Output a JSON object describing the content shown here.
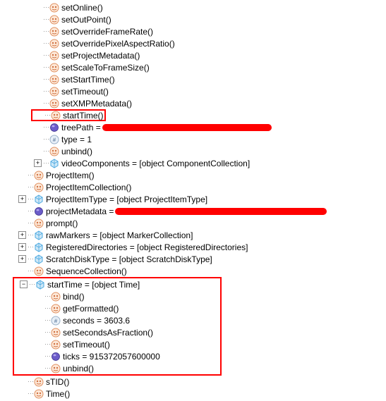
{
  "nodes": {
    "setOnline": "setOnline()",
    "setOutPoint": "setOutPoint()",
    "setOverrideFrameRate": "setOverrideFrameRate()",
    "setOverridePixelAspectRatio": "setOverridePixelAspectRatio()",
    "setProjectMetadata": "setProjectMetadata()",
    "setScaleToFrameSize": "setScaleToFrameSize()",
    "setStartTime": "setStartTime()",
    "setTimeout": "setTimeout()",
    "setXMPMetadata": "setXMPMetadata()",
    "startTimeMethod": "startTime()",
    "treePath": "treePath = ",
    "type": "type = 1",
    "unbind": "unbind()",
    "videoComponents": "videoComponents = [object ComponentCollection]",
    "ProjectItem": "ProjectItem()",
    "ProjectItemCollection": "ProjectItemCollection()",
    "ProjectItemType": "ProjectItemType = [object ProjectItemType]",
    "projectMetadata": "projectMetadata = ",
    "prompt": "prompt()",
    "rawMarkers": "rawMarkers = [object MarkerCollection]",
    "RegisteredDirectories": "RegisteredDirectories = [object RegisteredDirectories]",
    "ScratchDiskType": "ScratchDiskType = [object ScratchDiskType]",
    "SequenceCollection": "SequenceCollection()",
    "startTimeObj": "startTime = [object Time]",
    "bind": "bind()",
    "getFormatted": "getFormatted()",
    "seconds": "seconds = 3603.6",
    "setSecondsAsFraction": "setSecondsAsFraction()",
    "setTimeout2": "setTimeout()",
    "ticks": "ticks = 915372057600000",
    "unbind2": "unbind()",
    "sTID": "sTID()",
    "Time": "Time()"
  },
  "toggle": {
    "plus": "+",
    "minus": "−"
  }
}
